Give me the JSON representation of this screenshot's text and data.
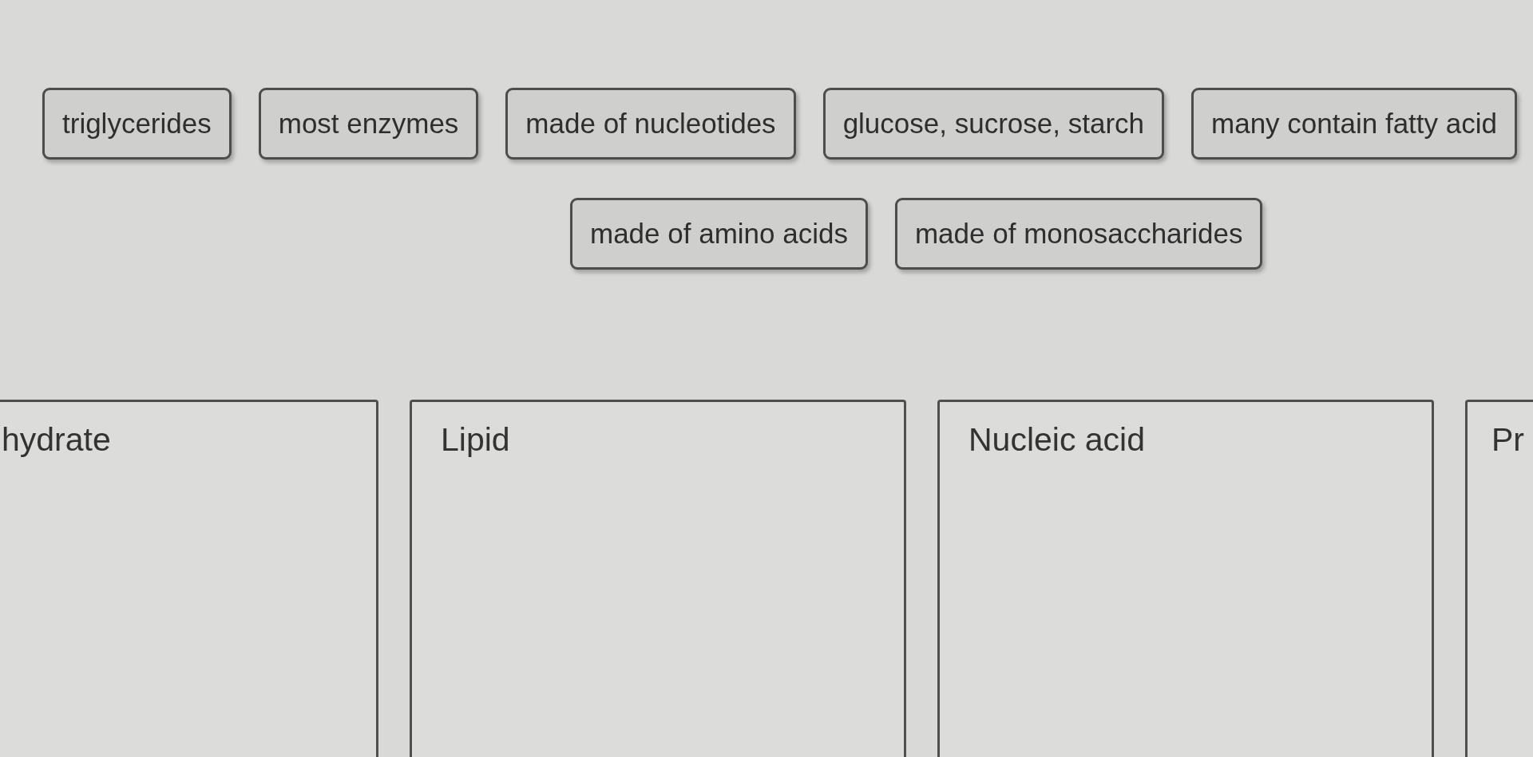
{
  "tile_rows": [
    [
      "triglycerides",
      "most enzymes",
      "made of nucleotides",
      "glucose, sucrose, starch",
      "many contain fatty acid"
    ],
    [
      "made of amino acids",
      "made of monosaccharides"
    ]
  ],
  "categories": [
    {
      "label": "hydrate"
    },
    {
      "label": "Lipid"
    },
    {
      "label": "Nucleic acid"
    },
    {
      "label": "Pr"
    }
  ]
}
